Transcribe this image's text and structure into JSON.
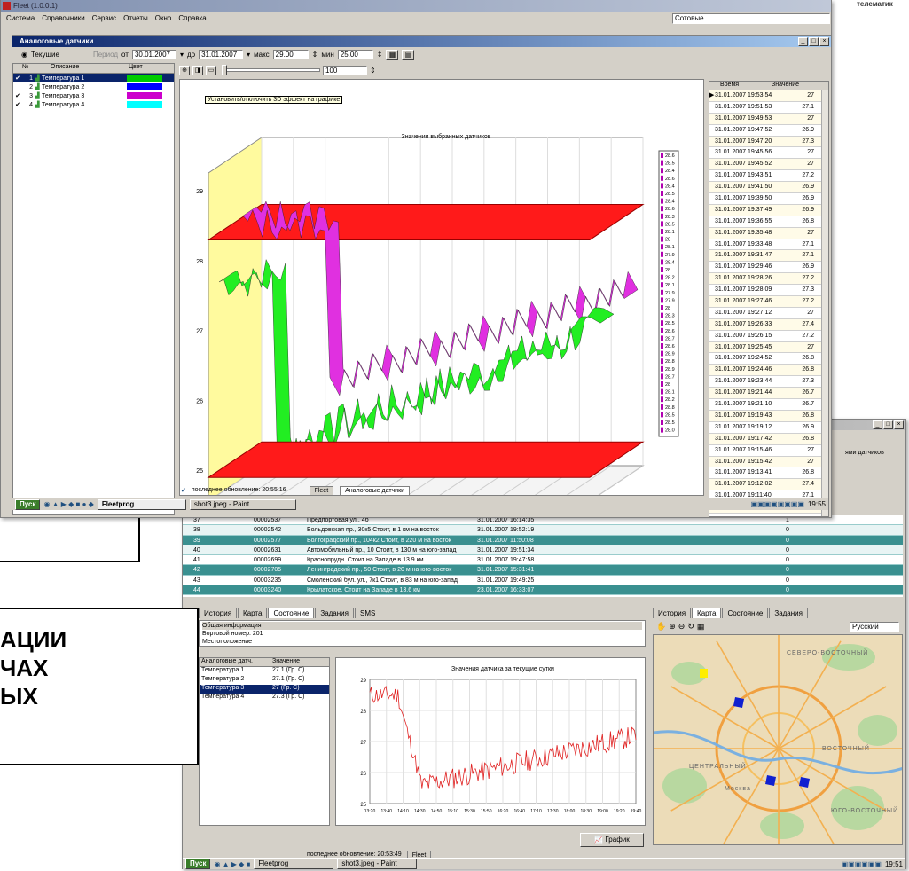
{
  "corner_text": "телематик",
  "main": {
    "title": "Fleet (1.0.0.1)",
    "menu": [
      "Система",
      "Справочники",
      "Сервис",
      "Отчеты",
      "Окно",
      "Справка"
    ],
    "map_layer": "Сотовые",
    "sub_title": "Аналоговые датчики",
    "toolbar": {
      "mode_label": "Текущие",
      "period_label": "Период",
      "from_label": "от",
      "from_date": "30.01.2007",
      "to_label": "до",
      "to_date": "31.01.2007",
      "max_label": "макс",
      "max_value": "29.00",
      "min_label": "мин",
      "min_value": "25.00",
      "slider_value": "100"
    },
    "sensor_table": {
      "headers": [
        "№",
        "Описание",
        "Цвет"
      ],
      "rows": [
        {
          "num": "1",
          "name": "Температура 1",
          "color": "#00cc00"
        },
        {
          "num": "2",
          "name": "Температура 2",
          "color": "#0000ff"
        },
        {
          "num": "3",
          "name": "Температура 3",
          "color": "#cc00cc"
        },
        {
          "num": "4",
          "name": "Температура 4",
          "color": "#00ffff"
        }
      ]
    },
    "tooltip": "Установить/отключить 3D эффект на графике",
    "chart_title": "Значения выбранных датчиков",
    "x_labels": [
      "13:30:00",
      "14:00:00",
      "14:30:00",
      "15:00:00",
      "15:30:00",
      "16:00:00",
      "16:30:00",
      "17:00:00",
      "17:30:00",
      "18:00:00",
      "18:30:00",
      "19:00:00",
      "19:30:00"
    ],
    "y_labels": [
      "29",
      "28",
      "27",
      "26",
      "25"
    ],
    "legend_values": [
      "28.6",
      "28.5",
      "28.4",
      "28.6",
      "28.4",
      "28.5",
      "28.4",
      "28.6",
      "28.3",
      "28.5",
      "28.1",
      "28",
      "28.1",
      "27.9",
      "28.4",
      "28",
      "28.2",
      "28.1",
      "27.9",
      "27.9",
      "28",
      "28.3",
      "28.5",
      "28.6",
      "28.7",
      "28.6",
      "28.9",
      "28.8",
      "28.9",
      "28.7",
      "28",
      "28.1",
      "28.2",
      "28.8",
      "28.5",
      "28.5",
      "28.0"
    ],
    "values_table": {
      "headers": [
        "Время",
        "Значение"
      ],
      "rows": [
        [
          "31.01.2007 19:53:54",
          "27"
        ],
        [
          "31.01.2007 19:51:53",
          "27.1"
        ],
        [
          "31.01.2007 19:49:53",
          "27"
        ],
        [
          "31.01.2007 19:47:52",
          "26.9"
        ],
        [
          "31.01.2007 19:47:20",
          "27.3"
        ],
        [
          "31.01.2007 19:45:56",
          "27"
        ],
        [
          "31.01.2007 19:45:52",
          "27"
        ],
        [
          "31.01.2007 19:43:51",
          "27.2"
        ],
        [
          "31.01.2007 19:41:50",
          "26.9"
        ],
        [
          "31.01.2007 19:39:50",
          "26.9"
        ],
        [
          "31.01.2007 19:37:49",
          "26.9"
        ],
        [
          "31.01.2007 19:36:55",
          "26.8"
        ],
        [
          "31.01.2007 19:35:48",
          "27"
        ],
        [
          "31.01.2007 19:33:48",
          "27.1"
        ],
        [
          "31.01.2007 19:31:47",
          "27.1"
        ],
        [
          "31.01.2007 19:29:46",
          "26.9"
        ],
        [
          "31.01.2007 19:28:26",
          "27.2"
        ],
        [
          "31.01.2007 19:28:09",
          "27.3"
        ],
        [
          "31.01.2007 19:27:46",
          "27.2"
        ],
        [
          "31.01.2007 19:27:12",
          "27"
        ],
        [
          "31.01.2007 19:26:33",
          "27.4"
        ],
        [
          "31.01.2007 19:26:15",
          "27.2"
        ],
        [
          "31.01.2007 19:25:45",
          "27"
        ],
        [
          "31.01.2007 19:24:52",
          "26.8"
        ],
        [
          "31.01.2007 19:24:46",
          "26.8"
        ],
        [
          "31.01.2007 19:23:44",
          "27.3"
        ],
        [
          "31.01.2007 19:21:44",
          "26.7"
        ],
        [
          "31.01.2007 19:21:10",
          "26.7"
        ],
        [
          "31.01.2007 19:19:43",
          "26.8"
        ],
        [
          "31.01.2007 19:19:12",
          "26.9"
        ],
        [
          "31.01.2007 19:17:42",
          "26.8"
        ],
        [
          "31.01.2007 19:15:46",
          "27"
        ],
        [
          "31.01.2007 19:15:42",
          "27"
        ],
        [
          "31.01.2007 19:13:41",
          "26.8"
        ],
        [
          "31.01.2007 19:12:02",
          "27.4"
        ],
        [
          "31.01.2007 19:11:40",
          "27.1"
        ],
        [
          "31.01.2007 19:10:08",
          "27.1"
        ]
      ]
    },
    "status_text": "последнее обновление: 20:55:16",
    "status_tabs": [
      "Fleet",
      "Аналоговые датчики"
    ],
    "taskbar": {
      "start": "Пуск",
      "task1": "Fleetprog",
      "task2": "shot3.jpeg - Paint",
      "clock": "19:55"
    }
  },
  "callouts": {
    "top_fragment": "Я",
    "bottom_lines": [
      "АЦИИ",
      "ЧАХ",
      "ЫХ"
    ]
  },
  "second": {
    "header_label": "ями датчиков",
    "list_rows": [
      {
        "num": "37",
        "id": "00002537",
        "addr": "Предпортовая ул., 4б",
        "date": "31.01.2007 16:14:35",
        "val": "1",
        "hl": false
      },
      {
        "num": "38",
        "id": "00002542",
        "addr": "Больдовская пр., 30к5 Стоит, в 1 км на восток",
        "date": "31.01.2007 19:52:19",
        "val": "0",
        "hl": false
      },
      {
        "num": "39",
        "id": "00002577",
        "addr": "Волгоградский пр., 104к2 Стоит, в 220 м на восток",
        "date": "31.01.2007 11:50:08",
        "val": "0",
        "hl": true
      },
      {
        "num": "40",
        "id": "00002631",
        "addr": "Автомобильный пр., 10 Стоит, в 130 м на юго-запад",
        "date": "31.01.2007 19:51:34",
        "val": "0",
        "hl": false
      },
      {
        "num": "41",
        "id": "00002699",
        "addr": "Краснопрудн. Стоит на Западе в 13.9 км",
        "date": "31.01.2007 19:47:58",
        "val": "0",
        "hl": false
      },
      {
        "num": "42",
        "id": "00002705",
        "addr": "Ленинградский пр., 50 Стоит, в 20 м на юго-восток",
        "date": "31.01.2007 15:31:41",
        "val": "0",
        "hl": true
      },
      {
        "num": "43",
        "id": "00003235",
        "addr": "Смоленский бул. ул., 7к1 Стоит, в 83 м на юго-запад",
        "date": "31.01.2007 19:49:25",
        "val": "0",
        "hl": false
      },
      {
        "num": "44",
        "id": "00003240",
        "addr": "Крылатское. Стоит на Западе в 13.6 км",
        "date": "23.01.2007 16:33:07",
        "val": "0",
        "hl": true
      }
    ],
    "left_tabs": [
      "История",
      "Карта",
      "Состояние",
      "Задания",
      "SMS"
    ],
    "info_lines": [
      "Общая информация",
      "Бортовой номер: 201",
      "Местоположение"
    ],
    "sensor_headers": [
      "Аналоговые датч.",
      "Значение"
    ],
    "sensors": [
      {
        "name": "Температура 1",
        "value": "27.1 (Гр. С)"
      },
      {
        "name": "Температура 2",
        "value": "27.1 (Гр. С)"
      },
      {
        "name": "Температура 3",
        "value": "27 (Гр. С)"
      },
      {
        "name": "Температура 4",
        "value": "27.3 (Гр. С)"
      }
    ],
    "chart2_title": "Значения датчика за текущие сутки",
    "chart2_y_labels": [
      "29",
      "28",
      "27",
      "26",
      "25"
    ],
    "chart2_x_labels": [
      "13:20",
      "13:40",
      "14:10",
      "14:30",
      "14:50",
      "15:10",
      "15:30",
      "15:50",
      "16:20",
      "16:40",
      "17:10",
      "17:30",
      "18:00",
      "18:30",
      "19:00",
      "19:20",
      "19:40"
    ],
    "graph_button": "График",
    "right_tabs": [
      "История",
      "Карта",
      "Состояние",
      "Задания"
    ],
    "map_lang": "Русский",
    "map_labels": [
      "СЕВЕРО-ВОСТОЧНЫЙ",
      "ВОСТОЧНЫЙ",
      "ЦЕНТРАЛЬНЫЙ",
      "ЮГО-ВОСТОЧНЫЙ",
      "Москва"
    ],
    "status_text": "последнее обновление: 20:53:49",
    "status_tab": "Fleet",
    "taskbar": {
      "start": "Пуск",
      "task1": "Fleetprog",
      "task2": "shot3.jpeg - Paint",
      "clock": "19:51"
    }
  }
}
